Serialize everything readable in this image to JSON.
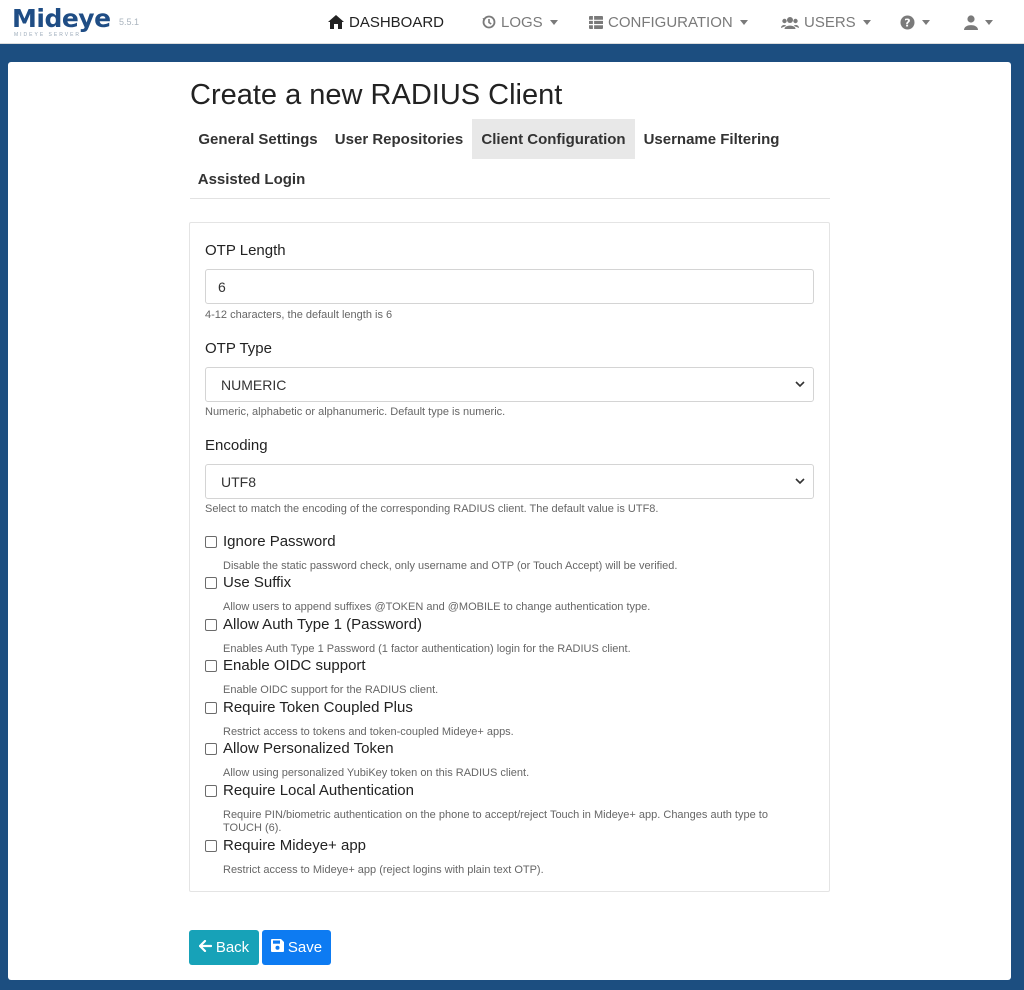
{
  "app": {
    "brand": "Mideye",
    "brand_sub": "MIDEYE SERVER",
    "version": "5.5.1"
  },
  "nav": {
    "dashboard": "DASHBOARD",
    "logs": "LOGS",
    "configuration": "CONFIGURATION",
    "users": "USERS"
  },
  "page": {
    "title": "Create a new RADIUS Client"
  },
  "tabs": [
    {
      "label": "General Settings",
      "active": false
    },
    {
      "label": "User Repositories",
      "active": false
    },
    {
      "label": "Client Configuration",
      "active": true
    },
    {
      "label": "Username Filtering",
      "active": false
    },
    {
      "label": "Assisted Login",
      "active": false
    }
  ],
  "form": {
    "otp_length": {
      "label": "OTP Length",
      "value": "6",
      "help": "4-12 characters, the default length is 6"
    },
    "otp_type": {
      "label": "OTP Type",
      "value": "NUMERIC",
      "help": "Numeric, alphabetic or alphanumeric. Default type is numeric."
    },
    "encoding": {
      "label": "Encoding",
      "value": "UTF8",
      "help": "Select to match the encoding of the corresponding RADIUS client. The default value is UTF8."
    },
    "checkboxes": [
      {
        "label": "Ignore Password",
        "help": "Disable the static password check, only username and OTP (or Touch Accept) will be verified.",
        "checked": false
      },
      {
        "label": "Use Suffix",
        "help": "Allow users to append suffixes @TOKEN and @MOBILE to change authentication type.",
        "checked": false
      },
      {
        "label": "Allow Auth Type 1 (Password)",
        "help": "Enables Auth Type 1 Password (1 factor authentication) login for the RADIUS client.",
        "checked": false
      },
      {
        "label": "Enable OIDC support",
        "help": "Enable OIDC support for the RADIUS client.",
        "checked": false
      },
      {
        "label": "Require Token Coupled Plus",
        "help": "Restrict access to tokens and token-coupled Mideye+ apps.",
        "checked": false
      },
      {
        "label": "Allow Personalized Token",
        "help": "Allow using personalized YubiKey token on this RADIUS client.",
        "checked": false
      },
      {
        "label": "Require Local Authentication",
        "help": "Require PIN/biometric authentication on the phone to accept/reject Touch in Mideye+ app. Changes auth type to TOUCH (6).",
        "checked": false
      },
      {
        "label": "Require Mideye+ app",
        "help": "Restrict access to Mideye+ app (reject logins with plain text OTP).",
        "checked": false
      }
    ]
  },
  "buttons": {
    "back": "Back",
    "save": "Save"
  },
  "colors": {
    "brand_blue": "#1f4d85",
    "background_blue": "#1c4e80",
    "back_button": "#17a2b8",
    "save_button": "#0d7bf2"
  }
}
